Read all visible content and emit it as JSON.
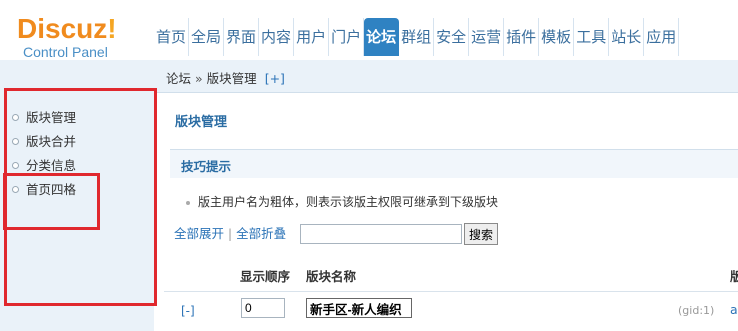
{
  "logo": {
    "brand": "Discuz",
    "bang": "!",
    "subtitle": "Control Panel"
  },
  "nav": {
    "items": [
      "首页",
      "全局",
      "界面",
      "内容",
      "用户",
      "门户",
      "论坛",
      "群组",
      "安全",
      "运营",
      "插件",
      "模板",
      "工具",
      "站长",
      "应用"
    ],
    "active": "论坛"
  },
  "sidebar": {
    "items": [
      {
        "label": "版块管理"
      },
      {
        "label": "版块合并"
      },
      {
        "label": "分类信息"
      },
      {
        "label": "首页四格"
      }
    ]
  },
  "breadcrumb": {
    "root": "论坛",
    "separator": "»",
    "current": "版块管理",
    "add": "[+]"
  },
  "page": {
    "title": "版块管理",
    "tips_title": "技巧提示",
    "tip": "版主用户名为粗体，则表示该版主权限可继承到下级版块"
  },
  "toolbar": {
    "expand_all": "全部展开",
    "divider": "|",
    "collapse_all": "全部折叠",
    "search_value": "",
    "search_button": "搜索"
  },
  "table": {
    "headers": [
      "显示顺序",
      "版块名称",
      "版"
    ],
    "rows": [
      {
        "toggle": "[-]",
        "order": "0",
        "name": "新手区-新人编织",
        "gid": "(gid:1)",
        "trail": "a"
      }
    ]
  },
  "colors": {
    "accent": "#2f82c2",
    "brand_orange": "#f08b1e",
    "sidebar_bg": "#eaf2f9",
    "highlight_red": "#e0282e"
  }
}
